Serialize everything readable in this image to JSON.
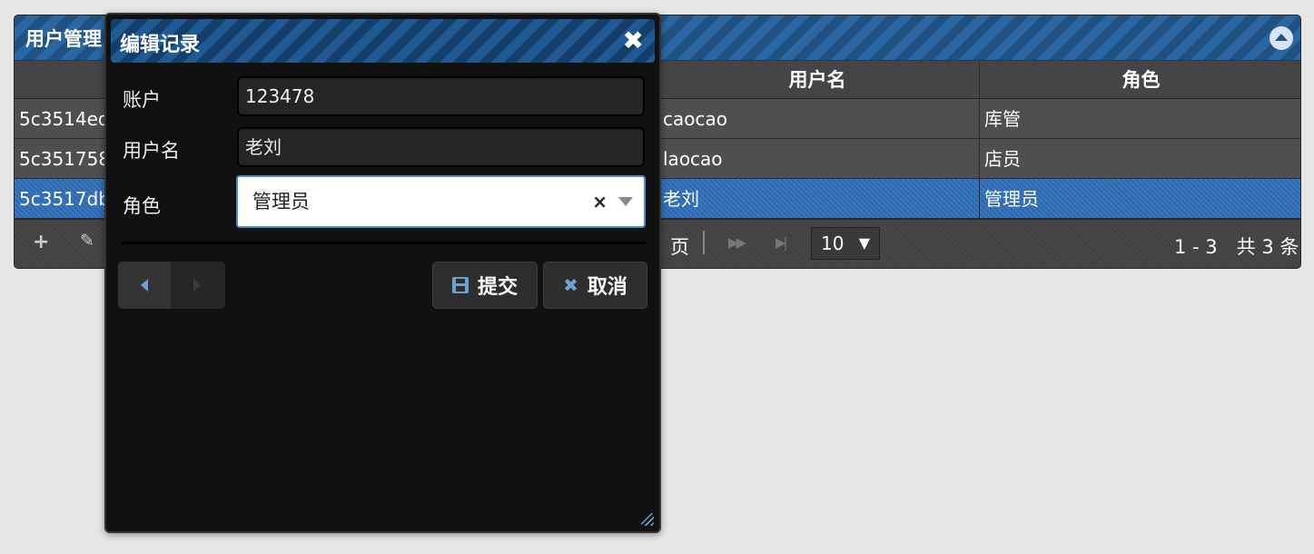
{
  "grid": {
    "caption": "用户管理",
    "headers": {
      "id": "",
      "username": "用户名",
      "role": "角色"
    },
    "rows": [
      {
        "id": "5c3514ed",
        "username": "caocao",
        "role": "库管",
        "selected": false
      },
      {
        "id": "5c351758",
        "username": "laocao",
        "role": "店员",
        "selected": false
      },
      {
        "id": "5c3517db",
        "username": "老刘",
        "role": "管理员",
        "selected": true
      }
    ],
    "pager": {
      "page_suffix": "页",
      "page_size": "10",
      "page_size_arrow": "▼",
      "info": "1 - 3　共 3 条",
      "add_icon": "+",
      "edit_icon": "✎",
      "next_icon": "▶▶",
      "last_icon": "▶|"
    }
  },
  "dialog": {
    "title": "编辑记录",
    "close_icon": "✖",
    "fields": {
      "account_label": "账户",
      "account_value": "123478",
      "username_label": "用户名",
      "username_value": "老刘",
      "role_label": "角色",
      "role_value": "管理员",
      "clear_icon": "×"
    },
    "buttons": {
      "submit": "提交",
      "cancel": "取消",
      "cancel_icon": "✖"
    }
  },
  "colors": {
    "accent": "#2a67a2",
    "selected_row": "#3a77c0",
    "dialog_bg": "#111111"
  }
}
